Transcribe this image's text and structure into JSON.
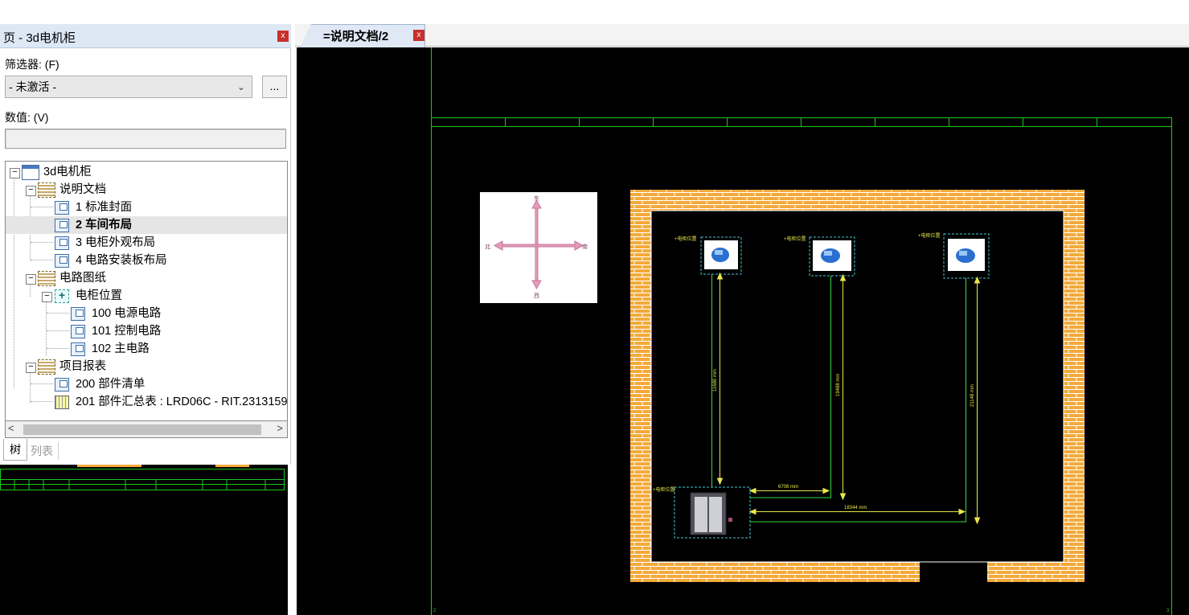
{
  "panel": {
    "title": "页 - 3d电机柜",
    "close": "x",
    "filter_label": "筛选器: (F)",
    "filter_value": "- 未激活 -",
    "filter_more": "...",
    "value_label": "数值: (V)",
    "value_text": ""
  },
  "tree": {
    "items": [
      {
        "label": "3d电机柜"
      },
      {
        "label": "说明文档"
      },
      {
        "label": "1 标准封面"
      },
      {
        "label": "2 车间布局"
      },
      {
        "label": "3 电柜外观布局"
      },
      {
        "label": "4 电路安装板布局"
      },
      {
        "label": "电路图纸"
      },
      {
        "label": "电柜位置"
      },
      {
        "label": "100 电源电路"
      },
      {
        "label": "101 控制电路"
      },
      {
        "label": "102 主电路"
      },
      {
        "label": "项目报表"
      },
      {
        "label": "200 部件清单"
      },
      {
        "label": "201 部件汇总表 : LRD06C - RIT.2313159"
      }
    ],
    "scroll_left": "<",
    "scroll_right": ">"
  },
  "bottom_tabs": {
    "tree": "树",
    "list": "列表"
  },
  "doc_tab": {
    "label": "=说明文档/2",
    "close": "x"
  },
  "drawing": {
    "compass": {
      "north": "北",
      "south": "南",
      "east": "东",
      "west": "西"
    },
    "location_label": "+电柜位置",
    "dims": {
      "d1": "11680 mm",
      "d2": "19488 mm",
      "d3": "21148 mm",
      "d4": "6708 mm",
      "d5": "18344 mm"
    },
    "corner_left": "2",
    "corner_right": "3"
  },
  "colors": {
    "canvas_bg": "#000000",
    "frame_green": "#1ec81e",
    "brick": "#f3a93a",
    "mortar": "#ffffff",
    "dim_yellow": "#e8e84a",
    "dashed_cyan": "#3fc8d8",
    "compass_pink": "#e39bb8"
  }
}
